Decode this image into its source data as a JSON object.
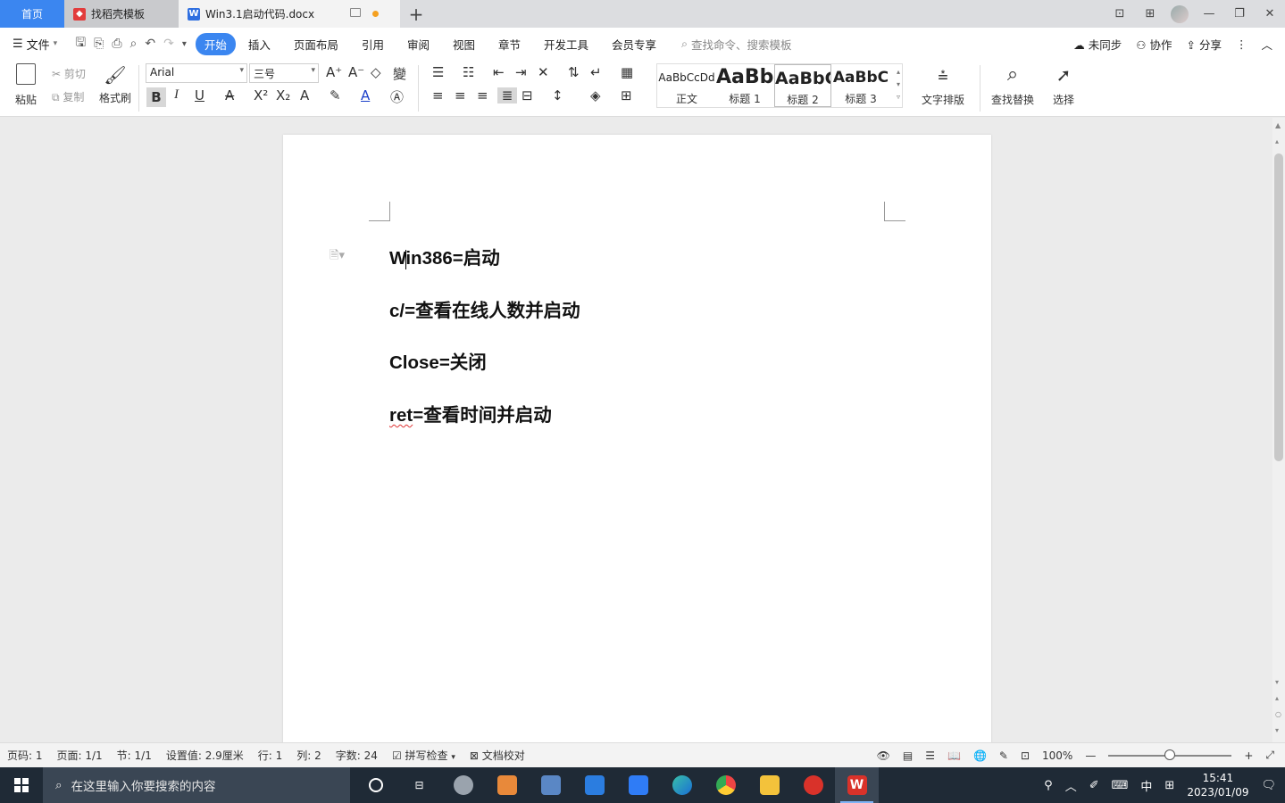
{
  "tabs": {
    "home": "首页",
    "templates": "找稻壳模板",
    "document": "Win3.1启动代码.docx"
  },
  "menu": {
    "file": "文件",
    "tabs": [
      "开始",
      "插入",
      "页面布局",
      "引用",
      "审阅",
      "视图",
      "章节",
      "开发工具",
      "会员专享"
    ],
    "search_placeholder": "查找命令、搜索模板",
    "sync": "未同步",
    "collab": "协作",
    "share": "分享"
  },
  "ribbon": {
    "paste": "粘贴",
    "cut": "剪切",
    "copy": "复制",
    "format_painter": "格式刷",
    "font_name": "Arial",
    "font_size": "三号",
    "styles": [
      {
        "sample": "AaBbCcDd",
        "label": "正文"
      },
      {
        "sample": "AaBb",
        "label": "标题 1"
      },
      {
        "sample": "AaBbC",
        "label": "标题 2"
      },
      {
        "sample": "AaBbC",
        "label": "标题 3"
      }
    ],
    "text_layout": "文字排版",
    "find_replace": "查找替换",
    "select": "选择"
  },
  "document": {
    "lines": [
      {
        "before": "W",
        "after": "in386=启动"
      },
      {
        "text": "c/=查看在线人数并启动"
      },
      {
        "text": "Close=关闭"
      },
      {
        "squiggle": "ret",
        "rest": "=查看时间并启动"
      }
    ]
  },
  "status": {
    "page_num": "页码: 1",
    "pages": "页面: 1/1",
    "section": "节: 1/1",
    "setting": "设置值: 2.9厘米",
    "row": "行: 1",
    "col": "列: 2",
    "word_count": "字数: 24",
    "spell_check": "拼写检查",
    "doc_proof": "文档校对",
    "zoom": "100%"
  },
  "taskbar": {
    "search_placeholder": "在这里输入你要搜索的内容",
    "ime": "中",
    "time": "15:41",
    "date": "2023/01/09"
  },
  "colors": {
    "accent": "#3b86f0",
    "taskbar": "#1f2a36"
  }
}
